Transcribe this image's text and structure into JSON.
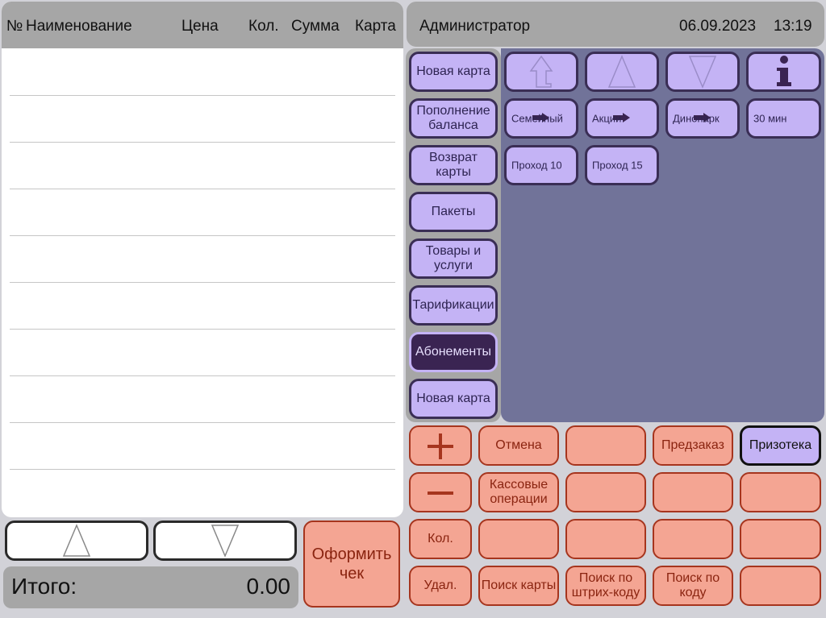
{
  "receipt": {
    "columns": {
      "num": "№",
      "name": "Наименование",
      "price": "Цена",
      "qty": "Кол.",
      "sum": "Сумма",
      "card": "Карта"
    }
  },
  "total": {
    "label": "Итого:",
    "value": "0.00"
  },
  "checkout": {
    "label": "Оформить чек"
  },
  "header": {
    "user": "Администратор",
    "date": "06.09.2023",
    "time": "13:19"
  },
  "categories": [
    "Новая карта",
    "Пополнение баланса",
    "Возврат карты",
    "Пакеты",
    "Товары и услуги",
    "Тарификации",
    "Абонементы",
    "Новая карта"
  ],
  "active_category": "Абонементы",
  "items": {
    "nav_icons": [
      "up-level-icon",
      "up-icon",
      "down-icon",
      "info-icon"
    ],
    "tiles": [
      "Семейный",
      "Акции",
      "Динопарк",
      "30 мин",
      "Проход 10",
      "Проход 15"
    ]
  },
  "keypad": {
    "plus": "+",
    "minus": "−",
    "cancel": "Отмена",
    "preorder": "Предзаказ",
    "prizoteka": "Призотека",
    "cash_ops": "Кассовые операции",
    "qty": "Кол.",
    "delete": "Удал.",
    "search_card": "Поиск карты",
    "search_barcode": "Поиск по штрих-коду",
    "search_code": "Поиск по коду"
  },
  "colors": {
    "salmon": "#f4a593",
    "lavender": "#c4b3f5",
    "active": "#3a2452",
    "panel": "#717399"
  }
}
